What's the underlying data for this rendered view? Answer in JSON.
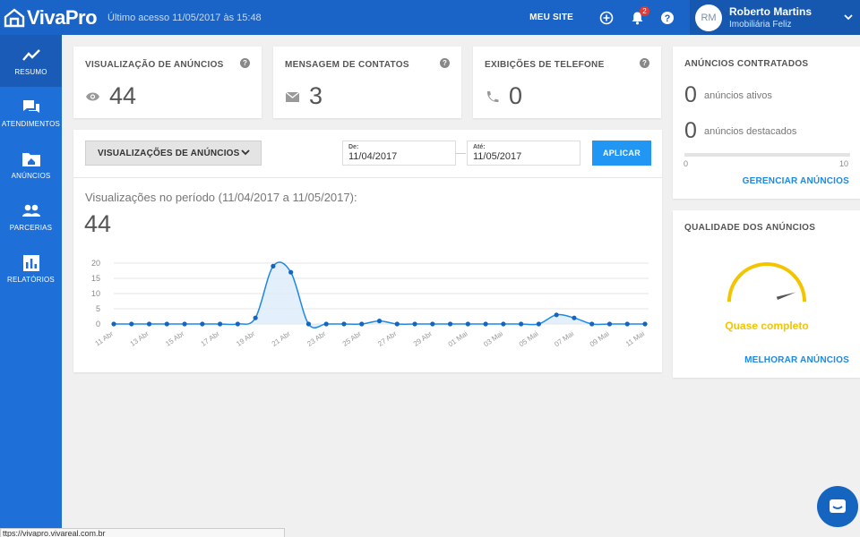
{
  "colors": {
    "topbar": "#1b64c7",
    "sidebar": "#1f6fd9",
    "accent": "#2196f3",
    "gauge": "#f2c500",
    "badge": "#e53935"
  },
  "header": {
    "logo_text": "VivaPro",
    "last_access": "Último acesso 11/05/2017 às 15:48",
    "meu_site": "MEU SITE",
    "notifications_count": "2",
    "user": {
      "initials": "RM",
      "name": "Roberto Martins",
      "company": "Imobiliária Feliz"
    }
  },
  "sidebar": {
    "items": [
      {
        "label": "RESUMO",
        "icon": "trend-line-icon",
        "active": true
      },
      {
        "label": "ATENDIMENTOS",
        "icon": "chat-bubbles-icon"
      },
      {
        "label": "ANÚNCIOS",
        "icon": "folder-home-icon"
      },
      {
        "label": "PARCERIAS",
        "icon": "people-icon"
      },
      {
        "label": "RELATÓRIOS",
        "icon": "bar-chart-icon"
      }
    ]
  },
  "stats": [
    {
      "title": "VISUALIZAÇÃO DE ANÚNCIOS",
      "value": "44",
      "icon": "eye-icon"
    },
    {
      "title": "MENSAGEM DE CONTATOS",
      "value": "3",
      "icon": "envelope-icon"
    },
    {
      "title": "EXIBIÇÕES DE TELEFONE",
      "value": "0",
      "icon": "phone-icon"
    }
  ],
  "filter": {
    "selected": "VISUALIZAÇÕES DE ANÚNCIOS",
    "from_label": "De:",
    "from_value": "11/04/2017",
    "to_label": "Até:",
    "to_value": "11/05/2017",
    "apply_label": "APLICAR"
  },
  "period": {
    "label": "Visualizações no período (11/04/2017 a 11/05/2017):",
    "total": "44"
  },
  "chart_data": {
    "type": "area",
    "x": [
      "11 Abr",
      "12 Abr",
      "13 Abr",
      "14 Abr",
      "15 Abr",
      "16 Abr",
      "17 Abr",
      "18 Abr",
      "19 Abr",
      "20 Abr",
      "21 Abr",
      "22 Abr",
      "23 Abr",
      "24 Abr",
      "25 Abr",
      "26 Abr",
      "27 Abr",
      "28 Abr",
      "29 Abr",
      "30 Abr",
      "01 Mai",
      "02 Mai",
      "03 Mai",
      "04 Mai",
      "05 Mai",
      "06 Mai",
      "07 Mai",
      "08 Mai",
      "09 Mai",
      "10 Mai",
      "11 Mai"
    ],
    "values": [
      0,
      0,
      0,
      0,
      0,
      0,
      0,
      0,
      2,
      19,
      17,
      0,
      0,
      0,
      0,
      1,
      0,
      0,
      0,
      0,
      0,
      0,
      0,
      0,
      0,
      3,
      2,
      0,
      0,
      0,
      0
    ],
    "tick_labels": [
      "11 Abr",
      "13 Abr",
      "15 Abr",
      "17 Abr",
      "19 Abr",
      "21 Abr",
      "23 Abr",
      "25 Abr",
      "27 Abr",
      "29 Abr",
      "01 Mai",
      "03 Mai",
      "05 Mai",
      "07 Mai",
      "09 Mai",
      "11 Mai"
    ],
    "yticks": [
      0,
      5,
      10,
      15,
      20
    ],
    "ylim": [
      0,
      20
    ],
    "grid": true,
    "title": "",
    "xlabel": "",
    "ylabel": ""
  },
  "contracted": {
    "title": "ANÚNCIOS CONTRATADOS",
    "active_count": "0",
    "active_label": "anúncios ativos",
    "featured_count": "0",
    "featured_label": "anúncios destacados",
    "bar_min": "0",
    "bar_max": "10",
    "usage_fraction": 0,
    "link": "GERENCIAR ANÚNCIOS"
  },
  "quality": {
    "title": "QUALIDADE DOS ANÚNCIOS",
    "status": "Quase completo",
    "level_fraction": 0.9,
    "link": "MELHORAR ANÚNCIOS"
  },
  "status_url": "ttps://vivapro.vivareal.com.br"
}
